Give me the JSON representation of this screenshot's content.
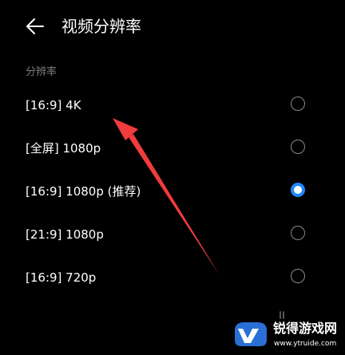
{
  "header": {
    "title": "视频分辨率",
    "back_icon": "arrow-left-icon"
  },
  "section": {
    "label": "分辨率"
  },
  "options": [
    {
      "label": "[16:9] 4K",
      "selected": false
    },
    {
      "label": "[全屏] 1080p",
      "selected": false
    },
    {
      "label": "[16:9] 1080p (推荐)",
      "selected": true
    },
    {
      "label": "[21:9] 1080p",
      "selected": false
    },
    {
      "label": "[16:9] 720p",
      "selected": false
    }
  ],
  "colors": {
    "background": "#000000",
    "accent": "#1f87ff",
    "annotation_arrow": "#f03c3c",
    "muted_text": "#7d7d7d"
  },
  "watermark": {
    "name": "锐得游戏网",
    "url": "www.ytruide.com"
  }
}
